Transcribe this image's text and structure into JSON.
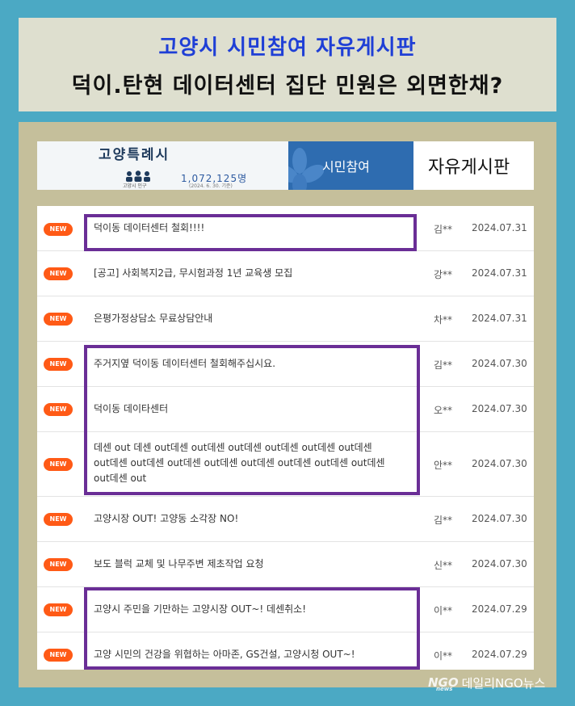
{
  "title": {
    "line1": "고양시 시민참여 자유게시판",
    "line2": "덕이.탄현 데이터센터 집단 민원은 외면한채?"
  },
  "banner": {
    "logo": "고양특례시",
    "population_label": "고양시 인구",
    "population": "1,072,125명",
    "population_date": "(2024. 6. 30. 기준)",
    "section": "시민참여",
    "board_name": "자유게시판"
  },
  "badge_label": "NEW",
  "posts": [
    {
      "subject": "덕이동 데이터센터 철회!!!!",
      "author": "김**",
      "date": "2024.07.31"
    },
    {
      "subject": "[공고] 사회복지2급, 무시험과정 1년 교육생 모집",
      "author": "강**",
      "date": "2024.07.31"
    },
    {
      "subject": "은평가정상담소 무료상담안내",
      "author": "차**",
      "date": "2024.07.31"
    },
    {
      "subject": "주거지옆 덕이동 데이터센터 철회해주십시요.",
      "author": "김**",
      "date": "2024.07.30"
    },
    {
      "subject": "덕이동 데이타센터",
      "author": "오**",
      "date": "2024.07.30"
    },
    {
      "subject": "데센 out 데센 out데센 out데센 out데센 out데센 out데센 out데센 out데센 out데센 out데센 out데센 out데센 out데센 out데센 out데센 out데센 out",
      "author": "안**",
      "date": "2024.07.30"
    },
    {
      "subject": "고양시장 OUT! 고양동 소각장 NO!",
      "author": "김**",
      "date": "2024.07.30"
    },
    {
      "subject": "보도 블럭 교체 및 나무주변 제초작업 요청",
      "author": "신**",
      "date": "2024.07.30"
    },
    {
      "subject": "고양시 주민을 기만하는 고양시장 OUT~! 데센취소!",
      "author": "이**",
      "date": "2024.07.29"
    },
    {
      "subject": "고양 시민의 건강을 위협하는 아마존, GS건설, 고양시청 OUT~!",
      "author": "이**",
      "date": "2024.07.29"
    }
  ],
  "watermark": {
    "logo": "NGO",
    "logo_sub": "news",
    "text": "데일리NGO뉴스"
  },
  "colors": {
    "background": "#4ba9c4",
    "panel": "#c5bf9b",
    "title_blue": "#1f3fd6",
    "badge": "#ff5a16",
    "highlight": "#6a2e96"
  }
}
